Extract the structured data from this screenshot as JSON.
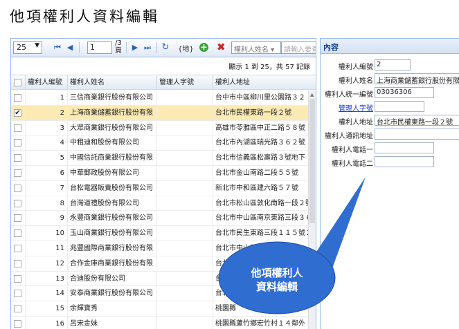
{
  "page_title": "他項權利人資料編輯",
  "toolbar": {
    "page_size": "25",
    "current_page": "1",
    "page_total": "/3頁",
    "map_label": "{地}",
    "field_select": "權利人姓名",
    "search_placeholder": "請輸入要查"
  },
  "info": "顯示 1 到 25，共 57 記錄",
  "columns": [
    "權利人編號",
    "權利人姓名",
    "管理人字號",
    "權利人地址"
  ],
  "rows": [
    {
      "no": "1",
      "name": "三信商業銀行股份有限公司",
      "code": "",
      "addr": "台中市中區柳川里公園路３２",
      "checked": false
    },
    {
      "no": "2",
      "name": "上海商業儲蓄銀行股份有限",
      "code": "",
      "addr": "台北市民權東路一段２號",
      "checked": true
    },
    {
      "no": "3",
      "name": "大眾商業銀行股份有限公司",
      "code": "",
      "addr": "高雄市苓雅區中正二路５８號",
      "checked": false
    },
    {
      "no": "4",
      "name": "中租迪和股份有限公司",
      "code": "",
      "addr": "台北市內湖區瑞光路３６２號",
      "checked": false
    },
    {
      "no": "5",
      "name": "中國信託商業銀行股份有限",
      "code": "",
      "addr": "台北市信義區松壽路３號地下",
      "checked": false
    },
    {
      "no": "6",
      "name": "中華郵政股份有限公司",
      "code": "",
      "addr": "台北市金山南路二段５５號",
      "checked": false
    },
    {
      "no": "7",
      "name": "台松電器販賣股份有限公司",
      "code": "",
      "addr": "新北市中和區建六路５７號",
      "checked": false
    },
    {
      "no": "8",
      "name": "台灣道禮股份有限公司",
      "code": "",
      "addr": "台北市松山區敦化南路一段２號",
      "checked": false
    },
    {
      "no": "9",
      "name": "永豐商業銀行股份有限公司",
      "code": "",
      "addr": "台北市中山區南京東路三段３６",
      "checked": false
    },
    {
      "no": "10",
      "name": "玉山商業銀行股份有限公司",
      "code": "",
      "addr": "台北市民生東路三段１１５號２",
      "checked": false
    },
    {
      "no": "11",
      "name": "兆豐國際商業銀行股份有限",
      "code": "",
      "addr": "台北市中山區吉林路１００",
      "checked": false
    },
    {
      "no": "12",
      "name": "合作金庫商業銀行股份有限",
      "code": "",
      "addr": "台北市",
      "checked": false
    },
    {
      "no": "13",
      "name": "合迪股份有限公司",
      "code": "",
      "addr": "台北",
      "checked": false
    },
    {
      "no": "14",
      "name": "安泰商業銀行股份有限公司",
      "code": "",
      "addr": "台北",
      "checked": false
    },
    {
      "no": "15",
      "name": "余輝寶秀",
      "code": "",
      "addr": "桃園縣",
      "checked": false
    },
    {
      "no": "16",
      "name": "呂宋金妹",
      "code": "",
      "addr": "桃園縣蘆竹鄉宏竹村１４鄰外",
      "checked": false
    }
  ],
  "form": {
    "header": "內容",
    "fields": [
      {
        "label": "權利人編號",
        "value": "2",
        "link": false
      },
      {
        "label": "權利人姓名",
        "value": "上海商業儲蓄銀行股份有限",
        "link": false
      },
      {
        "label": "權利人統一編號",
        "value": "03036306",
        "link": false
      },
      {
        "label": "管理人字號",
        "value": "",
        "link": true
      },
      {
        "label": "權利人地址",
        "value": "台北市民權東路一段２號",
        "link": false
      },
      {
        "label": "權利人通訊地址",
        "value": "",
        "link": false
      },
      {
        "label": "權利人電話一",
        "value": "",
        "link": false
      },
      {
        "label": "權利人電話二",
        "value": "",
        "link": false
      }
    ]
  },
  "callout": {
    "line1": "他項權利人",
    "line2": "資料編輯"
  },
  "colors": {
    "callout": "#2f6dd0",
    "selected_row": "#fbeab3",
    "link": "#1a3fd6"
  }
}
